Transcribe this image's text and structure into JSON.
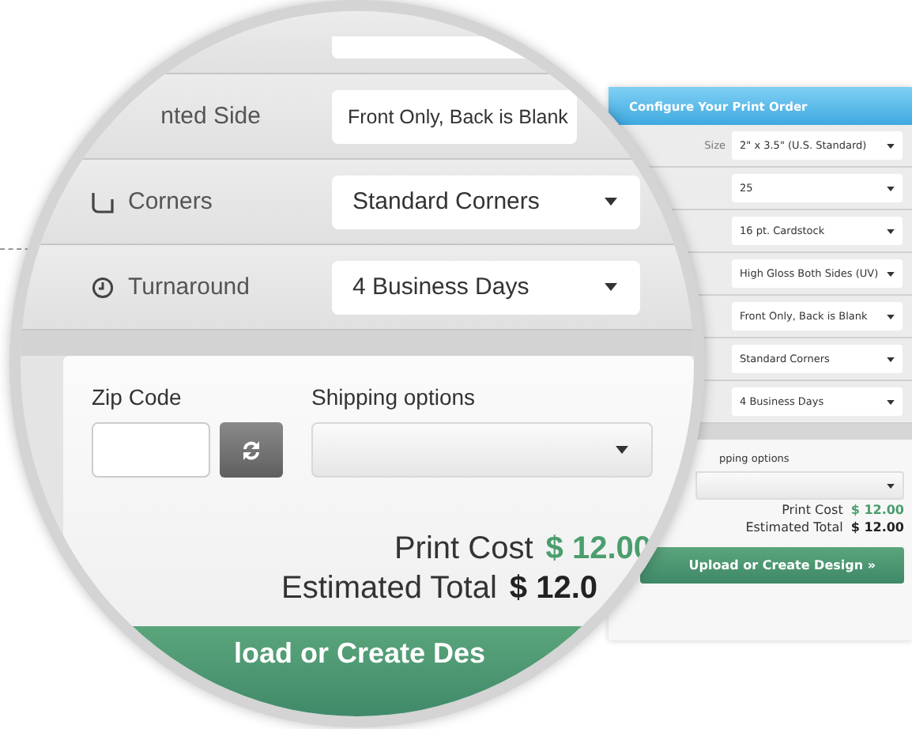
{
  "panel": {
    "title": "Configure Your Print Order",
    "size_label": "Size",
    "selects": [
      "2\" x 3.5\" (U.S. Standard)",
      "25",
      "16 pt. Cardstock",
      "High Gloss Both Sides (UV)",
      "Front Only, Back is Blank",
      "Standard Corners",
      "4 Business Days"
    ],
    "shipping_label": "pping options",
    "print_cost": {
      "label": "Print Cost",
      "value": "$ 12.00"
    },
    "estimated_total": {
      "label": "Estimated Total",
      "value": "$ 12.00"
    },
    "button": "Upload or Create Design »"
  },
  "lens": {
    "rows": [
      {
        "kind": "partial"
      },
      {
        "kind": "plain",
        "label": "nted Side",
        "value": "Front Only, Back is Blank"
      },
      {
        "kind": "corners",
        "label": "Corners",
        "value": "Standard Corners"
      },
      {
        "kind": "clock",
        "label": "Turnaround",
        "value": "4 Business Days"
      }
    ],
    "zip_label": "Zip Code",
    "shipping_label": "Shipping options",
    "print_cost": {
      "label": "Print Cost",
      "value": "$ 12.00"
    },
    "estimated_total": {
      "label": "Estimated Total",
      "value": "$ 12.0"
    },
    "button": "load or Create Des"
  }
}
